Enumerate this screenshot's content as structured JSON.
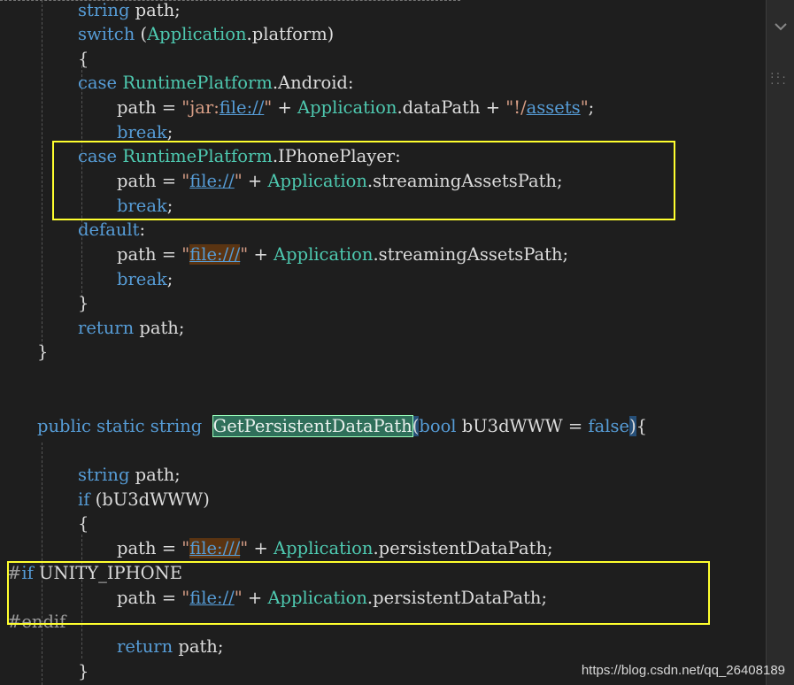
{
  "code": {
    "lines": [
      {
        "tokens": [
          [
            "kw",
            "string"
          ],
          [
            "pl",
            " path;"
          ]
        ]
      },
      {
        "tokens": [
          [
            "kw",
            "switch"
          ],
          [
            "pl",
            " ("
          ],
          [
            "ty",
            "Application"
          ],
          [
            "pl",
            ".platform)"
          ]
        ]
      },
      {
        "tokens": [
          [
            "pl",
            "{"
          ]
        ]
      },
      {
        "tokens": [
          [
            "kw",
            "case"
          ],
          [
            "pl",
            " "
          ],
          [
            "ty",
            "RuntimePlatform"
          ],
          [
            "pl",
            ".Android:"
          ]
        ]
      },
      {
        "tokens": [
          [
            "pl",
            "path = "
          ],
          [
            "str",
            "\"jar:"
          ],
          [
            "url",
            "file://"
          ],
          [
            "str",
            "\""
          ],
          [
            "pl",
            " + "
          ],
          [
            "ty",
            "Application"
          ],
          [
            "pl",
            ".dataPath + "
          ],
          [
            "str",
            "\"!/"
          ],
          [
            "url",
            "assets"
          ],
          [
            "str",
            "\""
          ],
          [
            "pl",
            ";"
          ]
        ]
      },
      {
        "tokens": [
          [
            "kw",
            "break"
          ],
          [
            "pl",
            ";"
          ]
        ]
      },
      {
        "tokens": [
          [
            "kw",
            "case"
          ],
          [
            "pl",
            " "
          ],
          [
            "ty",
            "RuntimePlatform"
          ],
          [
            "pl",
            ".IPhonePlayer:"
          ]
        ]
      },
      {
        "tokens": [
          [
            "pl",
            "path = "
          ],
          [
            "str",
            "\""
          ],
          [
            "url",
            "file://"
          ],
          [
            "str",
            "\""
          ],
          [
            "pl",
            " + "
          ],
          [
            "ty",
            "Application"
          ],
          [
            "pl",
            ".streamingAssetsPath;"
          ]
        ]
      },
      {
        "tokens": [
          [
            "kw",
            "break"
          ],
          [
            "pl",
            ";"
          ]
        ]
      },
      {
        "tokens": [
          [
            "kw",
            "default"
          ],
          [
            "pl",
            ":"
          ]
        ]
      },
      {
        "tokens": [
          [
            "pl",
            "path = "
          ],
          [
            "str",
            "\""
          ],
          [
            "urlhl",
            "file:///"
          ],
          [
            "str",
            "\""
          ],
          [
            "pl",
            " + "
          ],
          [
            "ty",
            "Application"
          ],
          [
            "pl",
            ".streamingAssetsPath;"
          ]
        ]
      },
      {
        "tokens": [
          [
            "kw",
            "break"
          ],
          [
            "pl",
            ";"
          ]
        ]
      },
      {
        "tokens": [
          [
            "pl",
            "}"
          ]
        ]
      },
      {
        "tokens": [
          [
            "kw",
            "return"
          ],
          [
            "pl",
            " path;"
          ]
        ]
      },
      {
        "tokens": [
          [
            "pl",
            "}"
          ]
        ]
      },
      {
        "tokens": []
      },
      {
        "tokens": []
      },
      {
        "tokens": [
          [
            "kw",
            "public"
          ],
          [
            "pl",
            " "
          ],
          [
            "kw",
            "static"
          ],
          [
            "pl",
            " "
          ],
          [
            "kw",
            "string"
          ],
          [
            "pl",
            "  "
          ],
          [
            "mth",
            "GetPersistentDataPath"
          ],
          [
            "sel",
            "("
          ],
          [
            "kw",
            "bool"
          ],
          [
            "pl",
            " bU3dWWW = "
          ],
          [
            "kw",
            "false"
          ],
          [
            "sel",
            ")"
          ],
          [
            "pl",
            "{"
          ]
        ]
      },
      {
        "tokens": []
      },
      {
        "tokens": [
          [
            "kw",
            "string"
          ],
          [
            "pl",
            " path;"
          ]
        ]
      },
      {
        "tokens": [
          [
            "kw",
            "if"
          ],
          [
            "pl",
            " (bU3dWWW)"
          ]
        ]
      },
      {
        "tokens": [
          [
            "pl",
            "{"
          ]
        ]
      },
      {
        "tokens": [
          [
            "pl",
            "path = "
          ],
          [
            "str",
            "\""
          ],
          [
            "urlhl",
            "file:///"
          ],
          [
            "str",
            "\""
          ],
          [
            "pl",
            " + "
          ],
          [
            "ty",
            "Application"
          ],
          [
            "pl",
            ".persistentDataPath;"
          ]
        ]
      },
      {
        "tokens": [
          [
            "pre",
            "#"
          ],
          [
            "kw",
            "if"
          ],
          [
            "pl",
            " UNITY_IPHONE"
          ]
        ]
      },
      {
        "tokens": [
          [
            "pl",
            "path = "
          ],
          [
            "str",
            "\""
          ],
          [
            "url",
            "file://"
          ],
          [
            "str",
            "\""
          ],
          [
            "pl",
            " + "
          ],
          [
            "ty",
            "Application"
          ],
          [
            "pl",
            ".persistentDataPath;"
          ]
        ]
      },
      {
        "tokens": [
          [
            "pre",
            "#endif"
          ]
        ]
      },
      {
        "tokens": [
          [
            "kw",
            "return"
          ],
          [
            "pl",
            " path;"
          ]
        ]
      },
      {
        "tokens": [
          [
            "pl",
            "}"
          ]
        ]
      }
    ]
  },
  "watermark": "https://blog.csdn.net/qq_26408189",
  "colors": {
    "background": "#1e1e1e",
    "keyword": "#569cd6",
    "type": "#4ec9b0",
    "string": "#d69d85",
    "highlight_box": "#ffff2e"
  },
  "icons": {
    "scroll_up": "chevron-down-icon",
    "grip": "grip-icon"
  }
}
